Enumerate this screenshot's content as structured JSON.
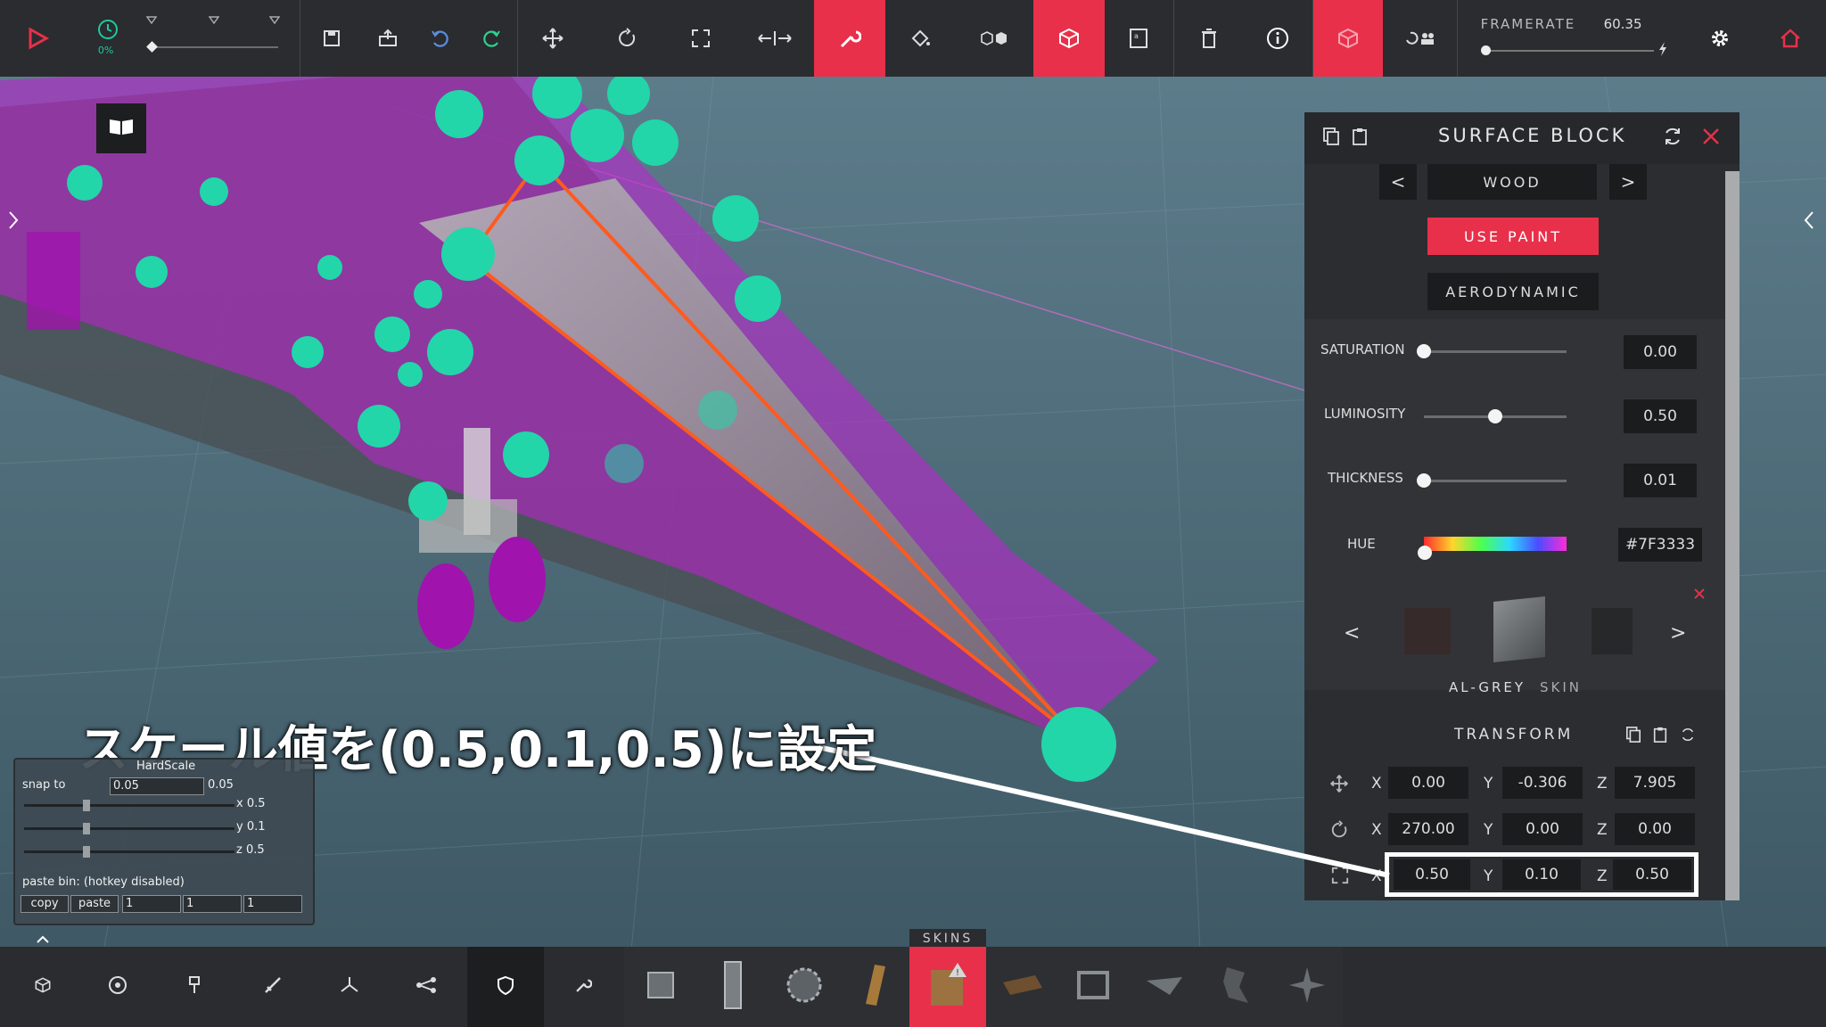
{
  "toolbar": {
    "time_scale": "0%",
    "framerate_label": "FRAMERATE",
    "framerate_value": "60.35",
    "accent_color": "#e8304a"
  },
  "panel": {
    "title": "SURFACE BLOCK",
    "material": "WOOD",
    "use_paint": "USE PAINT",
    "aerodynamic": "AERODYNAMIC",
    "saturation_label": "SATURATION",
    "saturation_value": "0.00",
    "saturation_level": 0.0,
    "luminosity_label": "LUMINOSITY",
    "luminosity_value": "0.50",
    "luminosity_level": 0.5,
    "thickness_label": "THICKNESS",
    "thickness_value": "0.01",
    "thickness_level": 0.0,
    "hue_label": "HUE",
    "hue_value": "#7F3333",
    "skin_name": "AL-GREY",
    "skin_suffix": "SKIN",
    "transform_label": "TRANSFORM",
    "position": {
      "x": "0.00",
      "y": "-0.306",
      "z": "7.905"
    },
    "rotation": {
      "x": "270.00",
      "y": "0.00",
      "z": "0.00"
    },
    "scale": {
      "x": "0.50",
      "y": "0.10",
      "z": "0.50"
    },
    "axis_x": "X",
    "axis_y": "Y",
    "axis_z": "Z"
  },
  "hardscale": {
    "title": "HardScale",
    "snap_label": "snap to",
    "snap_value": "0.05",
    "snap_display": "0.05",
    "x_label": "x 0.5",
    "y_label": "y 0.1",
    "z_label": "z 0.5",
    "paste_bin_label": "paste bin: (hotkey disabled)",
    "copy_label": "copy",
    "paste_label": "paste",
    "field1": "1",
    "field2": "1",
    "field3": "1"
  },
  "annotation": {
    "text": "スケール値を(0.5,0.1,0.5)に設定"
  },
  "bottom": {
    "skins_label": "SKINS"
  }
}
